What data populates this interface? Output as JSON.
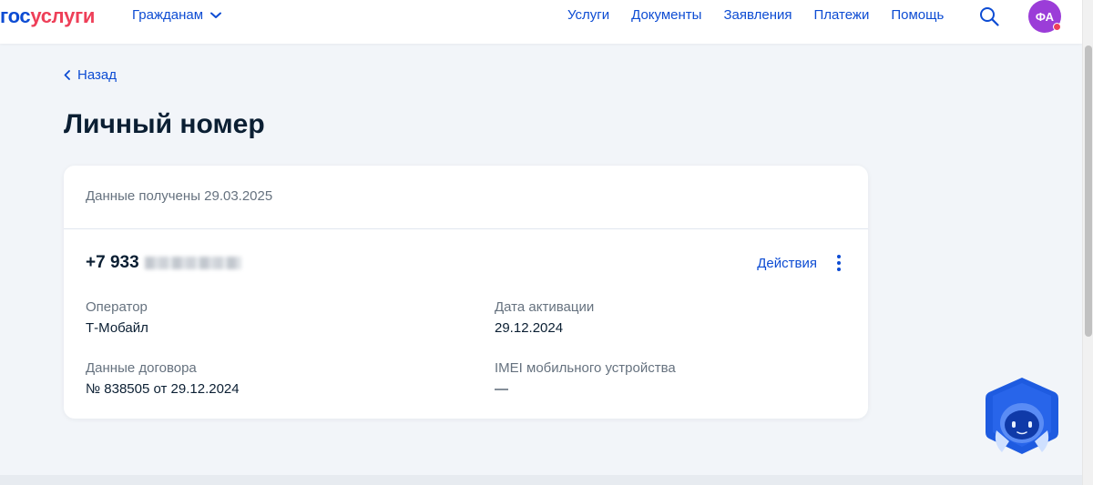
{
  "header": {
    "logo_part1": "гос",
    "logo_part2": "услуги",
    "audience_label": "Гражданам",
    "nav": [
      "Услуги",
      "Документы",
      "Заявления",
      "Платежи",
      "Помощь"
    ],
    "search_icon": "search-icon",
    "avatar_initials": "ФА"
  },
  "page": {
    "back_label": "Назад",
    "title": "Личный номер"
  },
  "card": {
    "received": "Данные получены 29.03.2025",
    "phone_prefix": "+7 933",
    "actions_label": "Действия",
    "fields": [
      {
        "label": "Оператор",
        "value": "Т-Мобайл"
      },
      {
        "label": "Дата активации",
        "value": "29.12.2024"
      },
      {
        "label": "Данные договора",
        "value": "№ 838505 от 29.12.2024"
      },
      {
        "label": "IMEI мобильного устройства",
        "value": "—"
      }
    ]
  },
  "colors": {
    "accent": "#0d4cd3",
    "brand_red": "#ee3f58",
    "avatar": "#9b3dd8",
    "background": "#f2f5f9"
  }
}
